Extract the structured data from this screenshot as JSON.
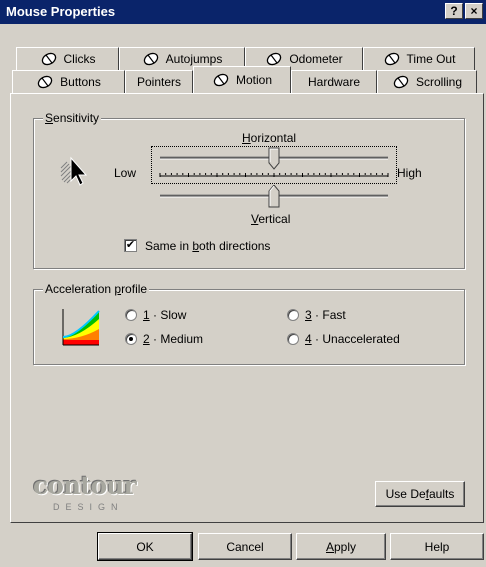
{
  "window": {
    "title": "Mouse Properties",
    "help_glyph": "?",
    "close_glyph": "×"
  },
  "tabs_row1": [
    {
      "label": "Clicks",
      "icon": "mouse-icon"
    },
    {
      "label": "Autojumps",
      "icon": "mouse-icon"
    },
    {
      "label": "Odometer",
      "icon": "mouse-icon"
    },
    {
      "label": "Time Out",
      "icon": "mouse-icon"
    }
  ],
  "tabs_row2": [
    {
      "label": "Buttons",
      "icon": "mouse-icon"
    },
    {
      "label": "Pointers",
      "icon": "none"
    },
    {
      "label": "Motion",
      "icon": "mouse-icon",
      "active": true
    },
    {
      "label": "Hardware",
      "icon": "none"
    },
    {
      "label": "Scrolling",
      "icon": "mouse-icon"
    }
  ],
  "sensitivity": {
    "group_label_pre": "",
    "group_label_ul": "S",
    "group_label_post": "ensitivity",
    "horizontal_ul": "H",
    "horizontal_rest": "orizontal",
    "vertical_ul": "V",
    "vertical_rest": "ertical",
    "low": "Low",
    "high": "High",
    "horizontal_value": 0.5,
    "vertical_value": 0.5,
    "same_pre": "Same in ",
    "same_ul": "b",
    "same_post": "oth directions",
    "same_checked": true,
    "check_glyph": "✔"
  },
  "acceleration": {
    "group_label_pre": "Acceleration ",
    "group_label_ul": "p",
    "group_label_post": "rofile",
    "options": [
      {
        "num": "1",
        "sep": " · ",
        "label": "Slow",
        "checked": false
      },
      {
        "num": "2",
        "sep": " · ",
        "label": "Medium",
        "checked": true
      },
      {
        "num": "3",
        "sep": " · ",
        "label": "Fast",
        "checked": false
      },
      {
        "num": "4",
        "sep": " · ",
        "label": "Unaccelerated",
        "checked": false
      }
    ]
  },
  "logo": {
    "word": "contour",
    "sub": "DESIGN"
  },
  "buttons": {
    "use_defaults_pre": "Use De",
    "use_defaults_ul": "f",
    "use_defaults_post": "aults",
    "ok": "OK",
    "cancel": "Cancel",
    "apply_ul": "A",
    "apply_rest": "pply",
    "help": "Help"
  },
  "colors": {
    "titlebar": "#0a246a",
    "face": "#d4d0c8"
  }
}
